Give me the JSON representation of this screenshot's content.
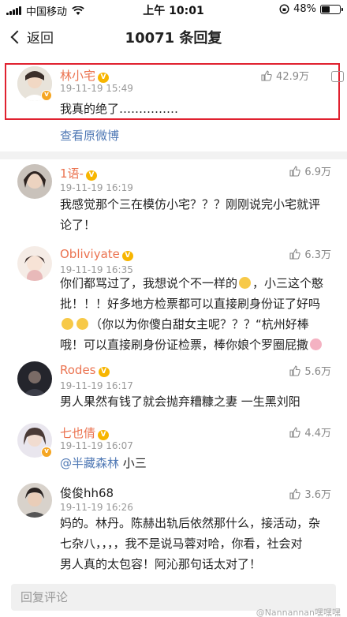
{
  "status_bar": {
    "carrier": "中国移动",
    "time": "上午 10:01",
    "battery_percent_text": "48%",
    "battery_level": 0.48
  },
  "nav": {
    "back_label": "返回",
    "title": "10071 条回复"
  },
  "original_comment": {
    "username": "林小宅",
    "timestamp": "19-11-19 15:49",
    "likes": "42.9万",
    "text": "我真的绝了……………",
    "view_original_label": "查看原微博"
  },
  "replies": [
    {
      "username": "1语-",
      "timestamp": "19-11-19 16:19",
      "likes": "6.9万",
      "lines": [
        "我感觉那个三在模仿小宅？？？刚刚说完小宅就评",
        "论了！"
      ]
    },
    {
      "username": "Obliviyate",
      "timestamp": "19-11-19 16:35",
      "likes": "6.3万",
      "line1": "你们都骂过了，我想说个不一样的",
      "line1b": "，小三这个憨",
      "line2": "批！！！好多地方检票都可以直接刷身份证了好吗",
      "line3": "（你以为你傻白甜女主呢？？？“杭州好棒",
      "line4": "哦！可以直接刷身份证检票，棒你娘个罗圈屁撒"
    },
    {
      "username": "Rodes",
      "timestamp": "19-11-19 16:17",
      "likes": "5.6万",
      "lines": [
        "男人果然有钱了就会抛弃糟糠之妻 一生黑刘阳"
      ]
    },
    {
      "username": "七也倩",
      "timestamp": "19-11-19 16:07",
      "likes": "4.4万",
      "mention": "@半藏森林",
      "text_after_mention": " 小三"
    },
    {
      "username": "俊俊hh68",
      "timestamp": "19-11-19 16:26",
      "likes": "3.6万",
      "lines": [
        "妈的。林丹。陈赫出轨后依然那什么，接活动，杂",
        "七杂八，，，，我不是说马蓉对哈，你看，社会对",
        "男人真的太包容！阿沁那句话太对了！"
      ]
    }
  ],
  "reply_bar": {
    "placeholder": "回复评论",
    "watermark": "@Nannannan嘿嘿嘿"
  },
  "colors": {
    "username": "#eb7350",
    "link": "#5079b5",
    "highlight_border": "#e0212f"
  }
}
